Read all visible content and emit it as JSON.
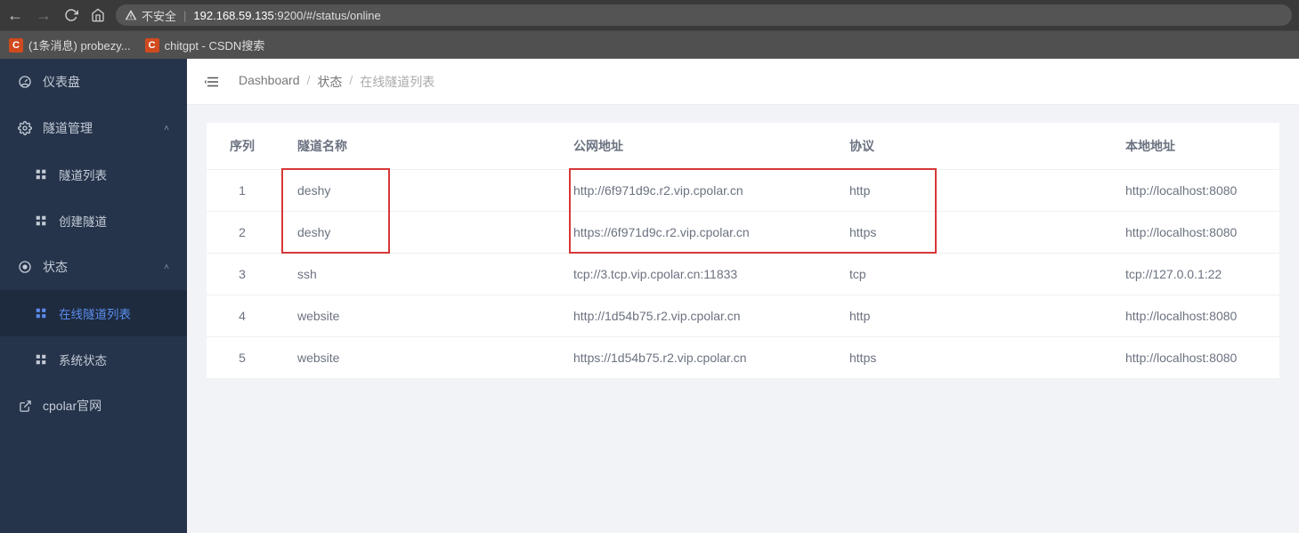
{
  "browser": {
    "insecure_label": "不安全",
    "url_host": "192.168.59.135",
    "url_port_path": ":9200/#/status/online"
  },
  "bookmarks": [
    {
      "favicon": "C",
      "label": "(1条消息) probezy..."
    },
    {
      "favicon": "C",
      "label": "chitgpt - CSDN搜索"
    }
  ],
  "sidebar": {
    "dashboard": "仪表盘",
    "tunnel_mgmt": "隧道管理",
    "tunnel_list": "隧道列表",
    "tunnel_create": "创建隧道",
    "status": "状态",
    "online_list": "在线隧道列表",
    "system_status": "系统状态",
    "official_site": "cpolar官网"
  },
  "breadcrumbs": {
    "dashboard": "Dashboard",
    "status": "状态",
    "current": "在线隧道列表"
  },
  "table": {
    "headers": {
      "seq": "序列",
      "name": "隧道名称",
      "public_addr": "公网地址",
      "protocol": "协议",
      "local_addr": "本地地址"
    },
    "rows": [
      {
        "seq": "1",
        "name": "deshy",
        "public_addr": "http://6f971d9c.r2.vip.cpolar.cn",
        "protocol": "http",
        "local_addr": "http://localhost:8080"
      },
      {
        "seq": "2",
        "name": "deshy",
        "public_addr": "https://6f971d9c.r2.vip.cpolar.cn",
        "protocol": "https",
        "local_addr": "http://localhost:8080"
      },
      {
        "seq": "3",
        "name": "ssh",
        "public_addr": "tcp://3.tcp.vip.cpolar.cn:11833",
        "protocol": "tcp",
        "local_addr": "tcp://127.0.0.1:22"
      },
      {
        "seq": "4",
        "name": "website",
        "public_addr": "http://1d54b75.r2.vip.cpolar.cn",
        "protocol": "http",
        "local_addr": "http://localhost:8080"
      },
      {
        "seq": "5",
        "name": "website",
        "public_addr": "https://1d54b75.r2.vip.cpolar.cn",
        "protocol": "https",
        "local_addr": "http://localhost:8080"
      }
    ]
  }
}
